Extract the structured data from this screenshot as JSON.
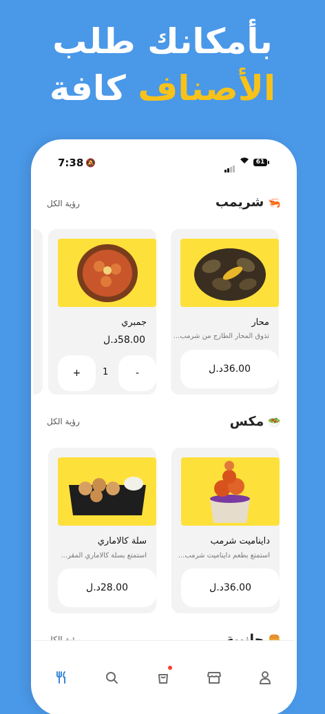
{
  "banner": {
    "line1": "بأمكانك طلب",
    "line2_accent": "الأصناف",
    "line2_rest": "كافة"
  },
  "status_bar": {
    "time": "7:38",
    "battery": "61"
  },
  "sections": [
    {
      "title": "شريمب",
      "see_all": "رؤية الكل",
      "items": [
        {
          "name": "محار",
          "desc": "تذوق المحار الطازج من شرمب...",
          "price": "36.00د.ل"
        },
        {
          "name": "جمبري",
          "price": "58.00د.ل",
          "quantity": "1",
          "minus": "-",
          "plus": "+"
        }
      ]
    },
    {
      "title": "مكس",
      "see_all": "رؤية الكل",
      "items": [
        {
          "name": "دايناميت شرمب",
          "desc": "استمتع بطعم دايناميت شرمب...",
          "price": "36.00د.ل"
        },
        {
          "name": "سلة كالاماري",
          "desc": "استمتع بسلة كالاماري المقر...",
          "price": "28.00د.ل"
        }
      ]
    },
    {
      "title": "جانبية",
      "see_all": "رؤية الكل"
    }
  ],
  "tabbar": {
    "items": [
      "menu-icon",
      "search-icon",
      "cart-icon",
      "store-icon",
      "profile-icon"
    ],
    "active_color": "#3a86d8",
    "inactive_color": "#6b6b6b"
  },
  "colors": {
    "background": "#4a98e8",
    "accent": "#f7c21a",
    "card_image_bg": "#fee03a"
  }
}
